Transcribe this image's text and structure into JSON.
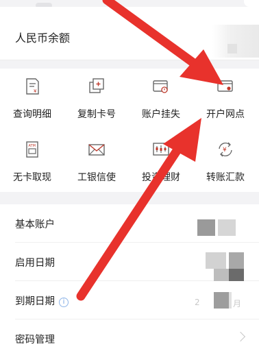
{
  "balance": {
    "label": "人民币余额"
  },
  "services": [
    {
      "label": "查询明细",
      "icon": "statement-icon"
    },
    {
      "label": "复制卡号",
      "icon": "copy-icon"
    },
    {
      "label": "账户挂失",
      "icon": "card-lock-icon"
    },
    {
      "label": "开户网点",
      "icon": "branch-location-icon"
    },
    {
      "label": "无卡取现",
      "icon": "atm-icon"
    },
    {
      "label": "工银信使",
      "icon": "envelope-icon"
    },
    {
      "label": "投资理财",
      "icon": "invest-chart-icon"
    },
    {
      "label": "转账汇款",
      "icon": "transfer-yen-icon"
    }
  ],
  "rows": {
    "basic_account": "基本账户",
    "start_date": "启用日期",
    "expiry_date": "到期日期",
    "expiry_date_partial": "2",
    "expiry_date_suffix": "月",
    "password": "密码管理"
  },
  "colors": {
    "arrow": "#e8322c",
    "icon": "#c0392b",
    "line": "#666"
  }
}
